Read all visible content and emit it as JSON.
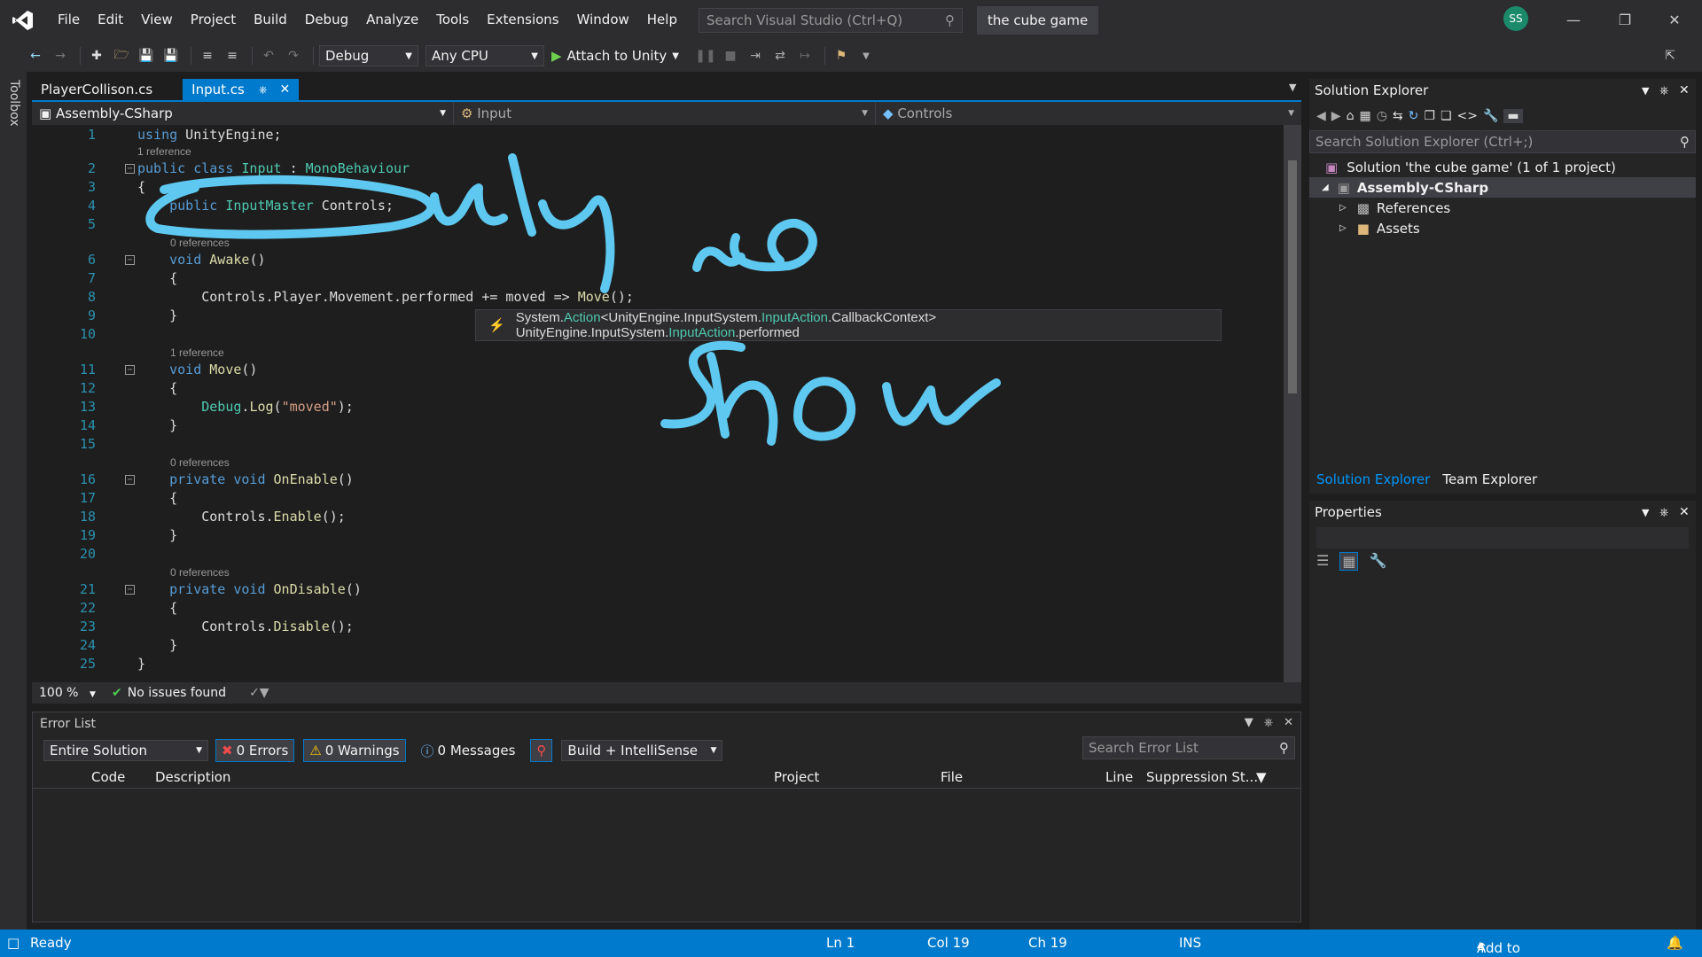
{
  "menu": [
    "File",
    "Edit",
    "View",
    "Project",
    "Build",
    "Debug",
    "Analyze",
    "Tools",
    "Extensions",
    "Window",
    "Help"
  ],
  "search": {
    "placeholder": "Search Visual Studio (Ctrl+Q)"
  },
  "project_title": "the cube game",
  "avatar_initials": "SS",
  "toolbar": {
    "config": "Debug",
    "platform": "Any CPU",
    "attach_label": "Attach to Unity"
  },
  "toolbox_label": "Toolbox",
  "tabs": [
    {
      "label": "PlayerCollison.cs"
    },
    {
      "label": "Input.cs"
    }
  ],
  "navbar": {
    "project": "Assembly-CSharp",
    "class": "Input",
    "member": "Controls"
  },
  "code": {
    "lines": [
      {
        "n": "1",
        "text": "using UnityEngine;"
      },
      {
        "n": "2",
        "text": "public class Input : MonoBehaviour"
      },
      {
        "n": "3",
        "text": "{"
      },
      {
        "n": "4",
        "text": "    public InputMaster Controls;"
      },
      {
        "n": "5",
        "text": ""
      },
      {
        "n": "6",
        "text": "    void Awake()"
      },
      {
        "n": "7",
        "text": "    {"
      },
      {
        "n": "8",
        "text": "        Controls.Player.Movement.performed += moved => Move();"
      },
      {
        "n": "9",
        "text": "    }"
      },
      {
        "n": "10",
        "text": ""
      },
      {
        "n": "11",
        "text": "    void Move()"
      },
      {
        "n": "12",
        "text": "    {"
      },
      {
        "n": "13",
        "text": "        Debug.Log(\"moved\");"
      },
      {
        "n": "14",
        "text": "    }"
      },
      {
        "n": "15",
        "text": ""
      },
      {
        "n": "16",
        "text": "    private void OnEnable()"
      },
      {
        "n": "17",
        "text": "    {"
      },
      {
        "n": "18",
        "text": "        Controls.Enable();"
      },
      {
        "n": "19",
        "text": "    }"
      },
      {
        "n": "20",
        "text": ""
      },
      {
        "n": "21",
        "text": "    private void OnDisable()"
      },
      {
        "n": "22",
        "text": "    {"
      },
      {
        "n": "23",
        "text": "        Controls.Disable();"
      },
      {
        "n": "24",
        "text": "    }"
      },
      {
        "n": "25",
        "text": "}"
      }
    ],
    "lens": {
      "class_refs": "1 reference",
      "awake_refs": "0 references",
      "move_refs": "1 reference",
      "onenable_refs": "0 references",
      "ondisable_refs": "0 references"
    }
  },
  "tooltip": {
    "p1": "System.",
    "p2": "Action",
    "p3": "<UnityEngine.InputSystem.",
    "p4": "InputAction",
    "p5": ".CallbackContext> UnityEngine.InputSystem.",
    "p6": "InputAction",
    "p7": ".performed"
  },
  "editor_status": {
    "zoom": "100 %",
    "issues": "No issues found"
  },
  "error_list": {
    "title": "Error List",
    "scope": "Entire Solution",
    "errors": "0 Errors",
    "warnings": "0 Warnings",
    "messages": "0 Messages",
    "build_filter": "Build + IntelliSense",
    "search_placeholder": "Search Error List",
    "columns": [
      "Code",
      "Description",
      "Project",
      "File",
      "Line",
      "Suppression St..."
    ]
  },
  "solution_explorer": {
    "title": "Solution Explorer",
    "search_placeholder": "Search Solution Explorer (Ctrl+;)",
    "tree": [
      {
        "label": "Solution 'the cube game' (1 of 1 project)"
      },
      {
        "label": "Assembly-CSharp"
      },
      {
        "label": "References"
      },
      {
        "label": "Assets"
      }
    ],
    "tabs": [
      "Solution Explorer",
      "Team Explorer"
    ]
  },
  "properties": {
    "title": "Properties"
  },
  "statusbar": {
    "ready": "Ready",
    "ln": "Ln 1",
    "col": "Col 19",
    "ch": "Ch 19",
    "ins": "INS",
    "source_control": "Add to Source Control"
  },
  "colors": {
    "accent": "#007acc",
    "keyword": "#569cd6",
    "type": "#4ec9b0",
    "string": "#d69d85",
    "annotation_ink": "#5ec8f0"
  }
}
